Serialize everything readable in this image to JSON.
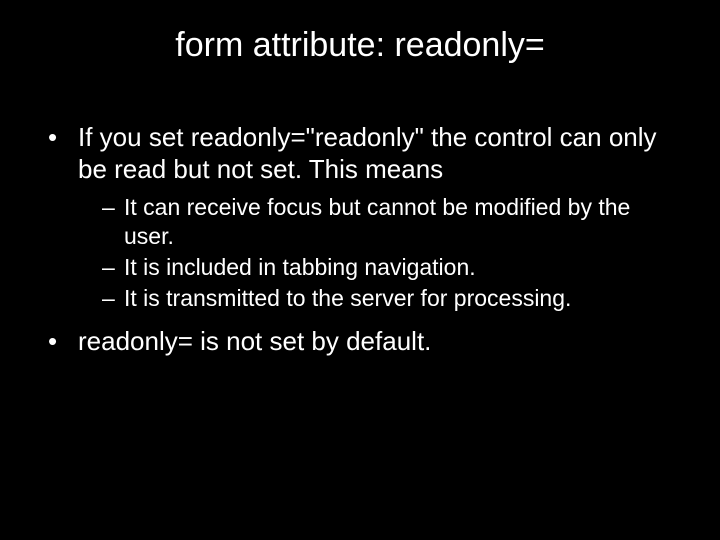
{
  "title": "form attribute: readonly=",
  "bullets": [
    {
      "text": "If you set readonly=\"readonly\" the control can only be read but not set. This means",
      "sub": [
        "It can receive focus but cannot be modified by the user.",
        "It is included in tabbing navigation.",
        "It is transmitted to the server for processing."
      ]
    },
    {
      "text": "readonly= is not set by default.",
      "sub": []
    }
  ]
}
